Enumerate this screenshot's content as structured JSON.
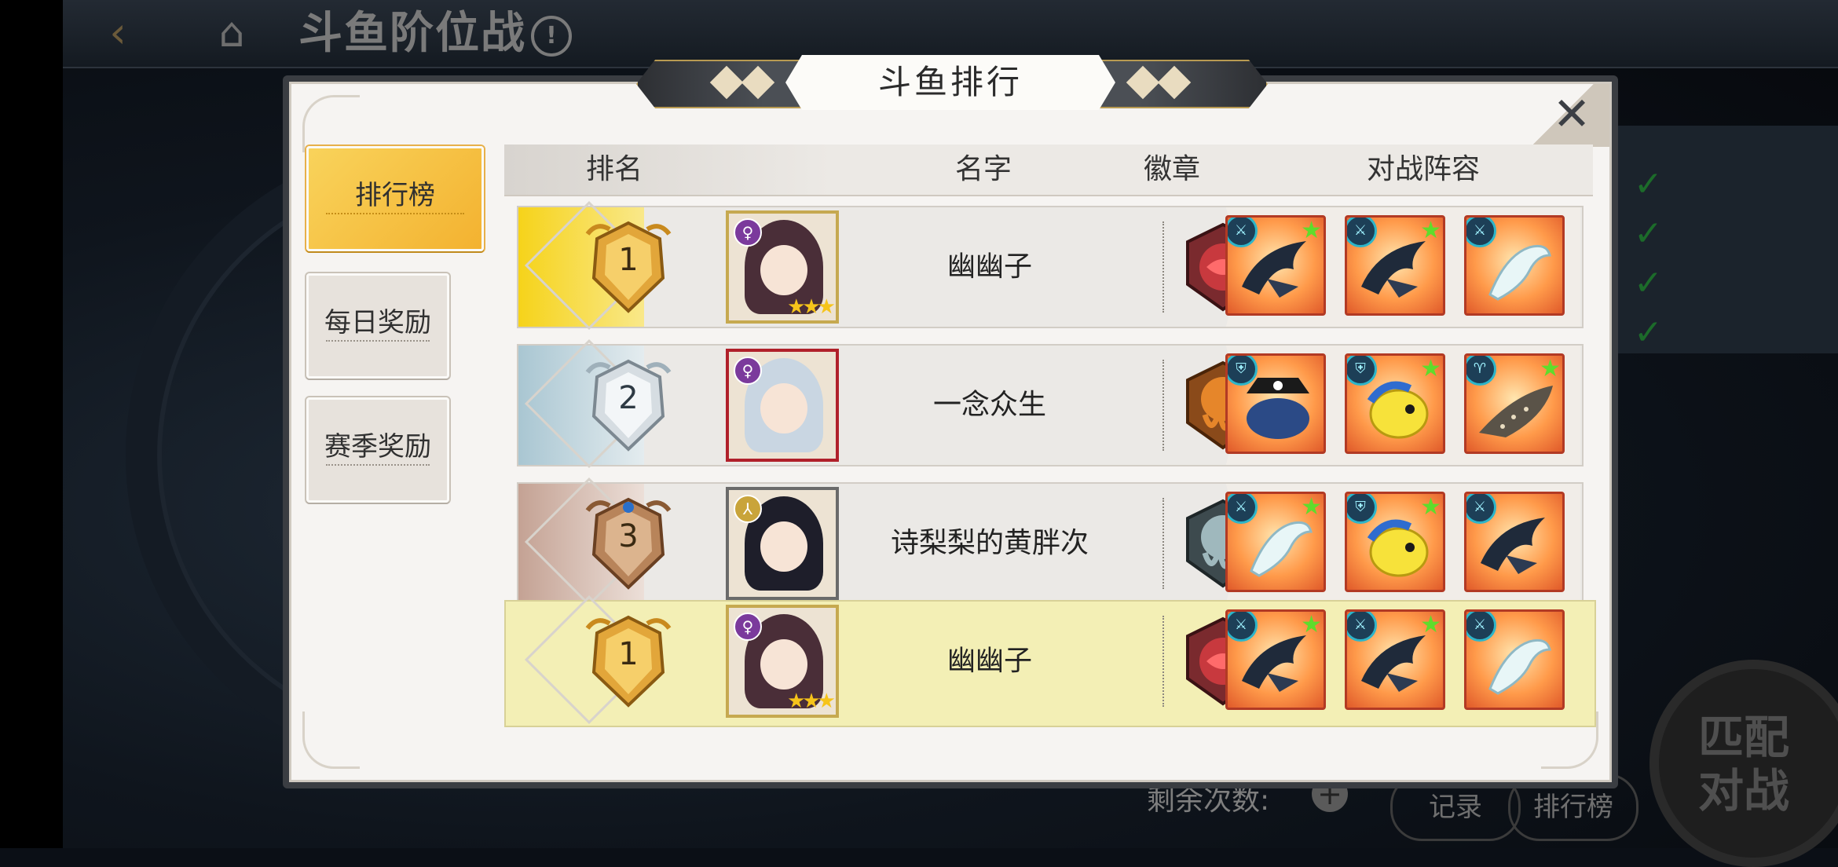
{
  "background": {
    "title": "斗鱼阶位战",
    "remaining_label": "剩余次数:",
    "record_label": "记录",
    "rank_label": "排行榜",
    "match_label_1": "匹配",
    "match_label_2": "对战"
  },
  "dialog": {
    "title": "斗鱼排行",
    "close": "✕"
  },
  "tabs": [
    {
      "label": "排行榜",
      "active": true
    },
    {
      "label": "每日奖励",
      "active": false
    },
    {
      "label": "赛季奖励",
      "active": false
    }
  ],
  "table": {
    "headers": [
      "排名",
      "名字",
      "徽章",
      "对战阵容"
    ],
    "rows": [
      {
        "rank": "1",
        "name": "幽幽子",
        "avatar_badge": "♀",
        "stars": "★★★",
        "emblem": "red",
        "lineup": [
          {
            "kind": "shark",
            "type_icon": "sword",
            "star": true
          },
          {
            "kind": "shark",
            "type_icon": "sword",
            "star": true
          },
          {
            "kind": "lizard",
            "type_icon": "sword",
            "star": false
          }
        ]
      },
      {
        "rank": "2",
        "name": "一念众生",
        "avatar_badge": "♀",
        "stars": "",
        "emblem": "orange",
        "lineup": [
          {
            "kind": "pirate",
            "type_icon": "shield",
            "star": false
          },
          {
            "kind": "yellowfish",
            "type_icon": "shield",
            "star": true
          },
          {
            "kind": "whaleshark",
            "type_icon": "cup",
            "star": true
          }
        ]
      },
      {
        "rank": "3",
        "name": "诗梨梨的黄胖次",
        "avatar_badge": "⅄",
        "stars": "",
        "emblem": "steel",
        "lineup": [
          {
            "kind": "lizard",
            "type_icon": "sword",
            "star": true
          },
          {
            "kind": "yellowfish",
            "type_icon": "shield",
            "star": true
          },
          {
            "kind": "shark",
            "type_icon": "sword",
            "star": false
          }
        ]
      }
    ],
    "self_row": {
      "rank": "1",
      "name": "幽幽子",
      "avatar_badge": "♀",
      "stars": "★★★"
    }
  },
  "colors": {
    "gold": "#f3b230",
    "silver": "#b9c7cf",
    "bronze": "#c9a48a",
    "self_highlight": "#f3efb5"
  }
}
